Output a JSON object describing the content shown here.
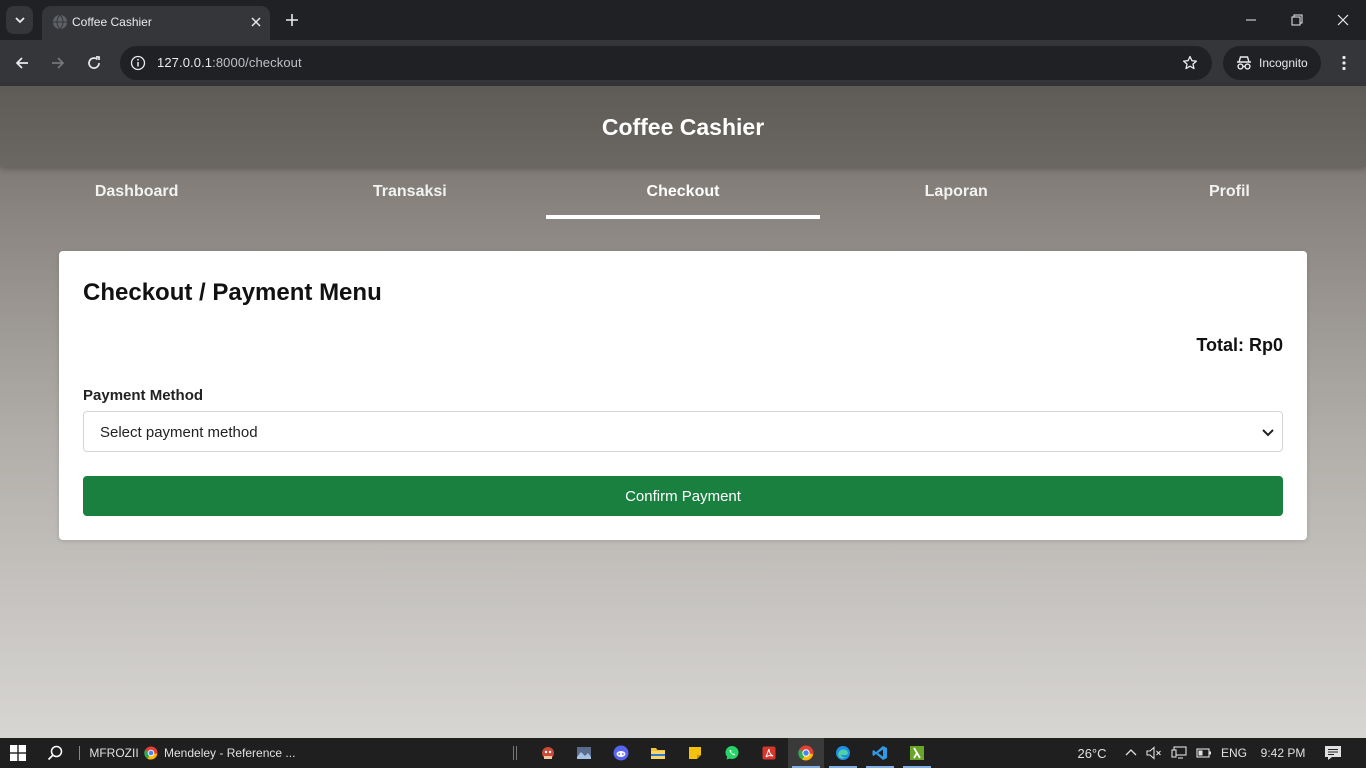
{
  "browser": {
    "tab_title": "Coffee Cashier",
    "url_host": "127.0.0.1",
    "url_path": ":8000/checkout",
    "profile_label": "Incognito"
  },
  "app": {
    "title": "Coffee Cashier",
    "nav": [
      {
        "label": "Dashboard",
        "active": false
      },
      {
        "label": "Transaksi",
        "active": false
      },
      {
        "label": "Checkout",
        "active": true
      },
      {
        "label": "Laporan",
        "active": false
      },
      {
        "label": "Profil",
        "active": false
      }
    ]
  },
  "checkout": {
    "heading": "Checkout / Payment Menu",
    "total_label": "Total: Rp0",
    "payment_method_label": "Payment Method",
    "payment_method_selected": "Select payment method",
    "confirm_label": "Confirm Payment"
  },
  "taskbar": {
    "user_label": "MFROZII",
    "window_label": "Mendeley - Reference ...",
    "temperature": "26°C",
    "language": "ENG",
    "time": "9:42 PM"
  },
  "colors": {
    "confirm_button": "#198040",
    "browser_dark": "#202124",
    "browser_toolbar": "#35363a",
    "header_bg": "#5e5a55"
  }
}
